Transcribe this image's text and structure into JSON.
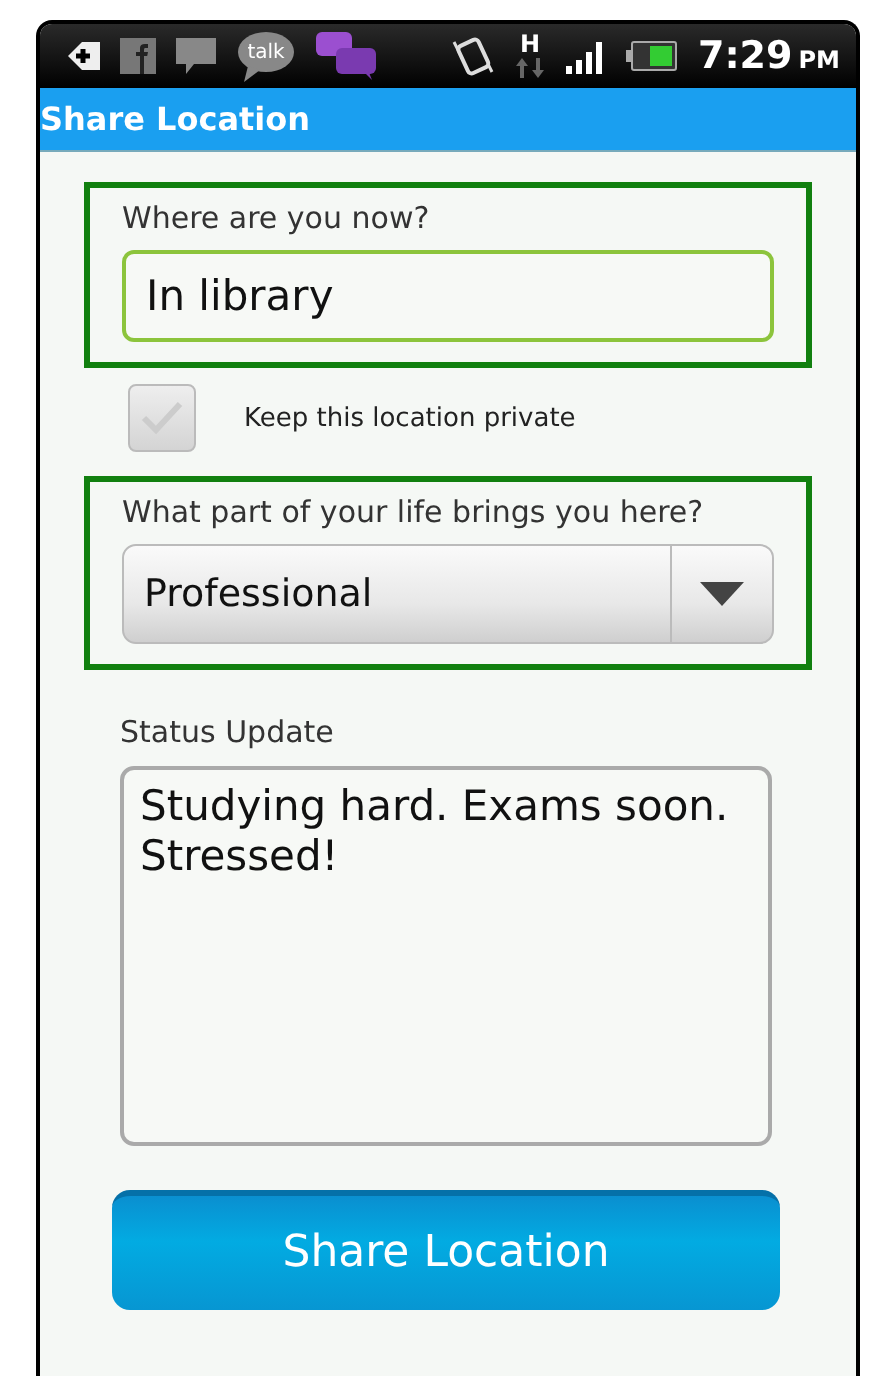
{
  "status_bar": {
    "talk_label": "talk",
    "network_type": "H",
    "time": "7:29",
    "period": "PM"
  },
  "title": "Share Location",
  "location": {
    "label": "Where are you now?",
    "value": "In library"
  },
  "private": {
    "label": "Keep this location private",
    "checked": true,
    "disabled": true
  },
  "life_part": {
    "label": "What part of your life brings you here?",
    "value": "Professional"
  },
  "status": {
    "label": "Status Update",
    "value": "Studying hard. Exams soon. Stressed!"
  },
  "button": "Share Location"
}
